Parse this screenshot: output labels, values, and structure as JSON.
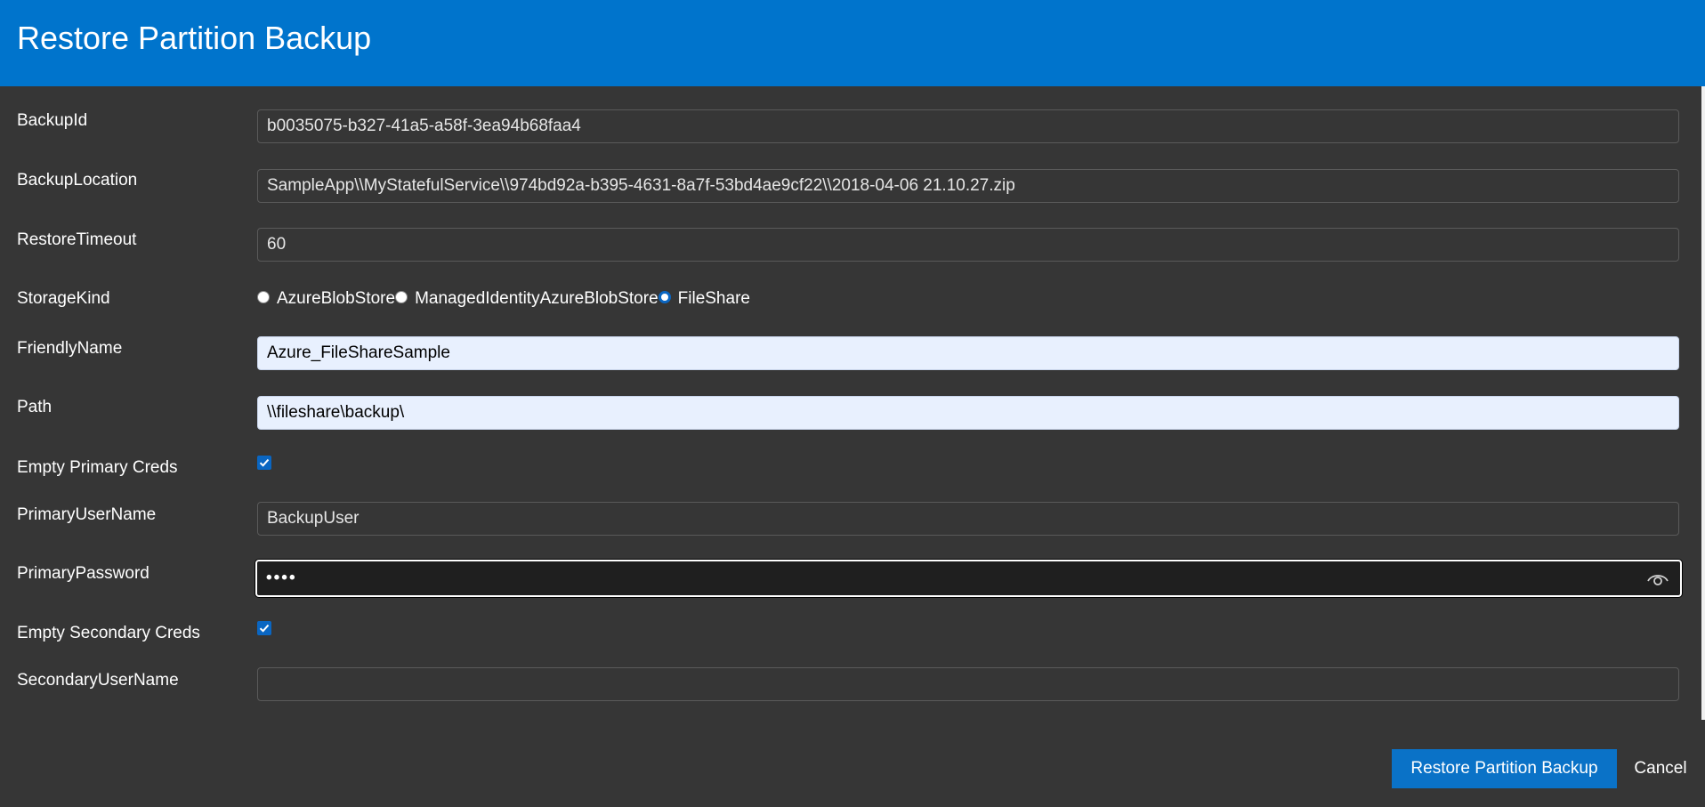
{
  "dialog": {
    "title": "Restore Partition Backup"
  },
  "fields": {
    "backup_id": {
      "label": "BackupId",
      "value": "b0035075-b327-41a5-a58f-3ea94b68faa4"
    },
    "backup_location": {
      "label": "BackupLocation",
      "value": "SampleApp\\\\MyStatefulService\\\\974bd92a-b395-4631-8a7f-53bd4ae9cf22\\\\2018-04-06 21.10.27.zip"
    },
    "restore_timeout": {
      "label": "RestoreTimeout",
      "value": "60"
    },
    "storage_kind": {
      "label": "StorageKind",
      "options": [
        "AzureBlobStore",
        "ManagedIdentityAzureBlobStore",
        "FileShare"
      ],
      "selected": "FileShare"
    },
    "friendly_name": {
      "label": "FriendlyName",
      "value": "Azure_FileShareSample"
    },
    "path": {
      "label": "Path",
      "value": "\\\\fileshare\\backup\\"
    },
    "empty_primary_creds": {
      "label": "Empty Primary Creds",
      "checked": true
    },
    "primary_user_name": {
      "label": "PrimaryUserName",
      "value": "BackupUser"
    },
    "primary_password": {
      "label": "PrimaryPassword",
      "value": "••••"
    },
    "empty_secondary_creds": {
      "label": "Empty Secondary Creds",
      "checked": true
    },
    "secondary_user_name": {
      "label": "SecondaryUserName",
      "value": ""
    }
  },
  "actions": {
    "submit_label": "Restore Partition Backup",
    "cancel_label": "Cancel"
  },
  "colors": {
    "header": "#0074cc",
    "background": "#363636",
    "accent": "#0a72c7",
    "autofill": "#e8f0fe"
  },
  "icons": {
    "password_toggle": "eye-icon",
    "checkbox_mark": "checkmark-icon"
  }
}
